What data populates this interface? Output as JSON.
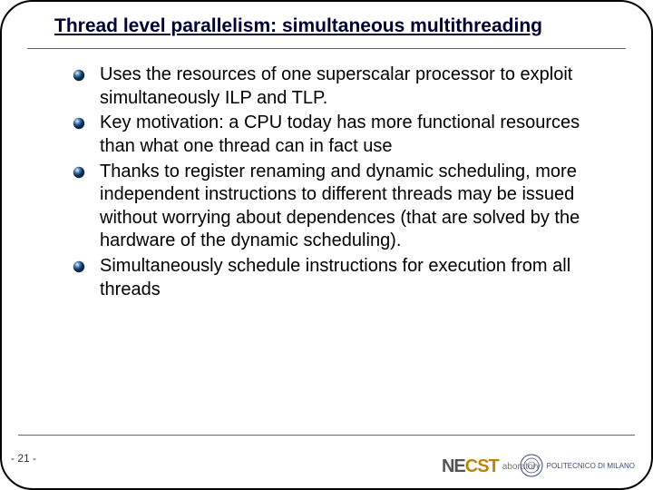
{
  "title": "Thread level parallelism: simultaneous multithreading",
  "bullets": [
    "Uses the resources of one superscalar processor to exploit simultaneously ILP and TLP.",
    "Key motivation: a CPU today has more functional resources than what one thread can in fact use",
    "Thanks to register renaming and dynamic scheduling, more independent instructions to different threads may be issued without worrying about dependences (that are solved by the hardware of the dynamic scheduling).",
    "Simultaneously schedule instructions for execution from all threads"
  ],
  "page_number": "- 21 -",
  "logos": {
    "necst_prefix": "NE",
    "necst_suffix": "CST",
    "necst_sub": "aboratory",
    "polimi": "POLITECNICO DI MILANO"
  }
}
